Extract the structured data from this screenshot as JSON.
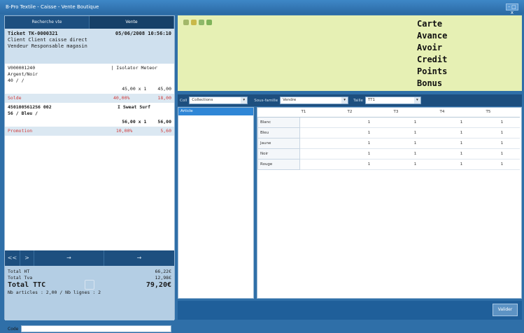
{
  "window": {
    "title": "B-Pro Textile - Caisse - Vente Boutique",
    "controls": "- □ x"
  },
  "tabs": [
    "Recherche vte",
    "Vente"
  ],
  "ticket": {
    "number_label": "Ticket   TK-0000321",
    "date": "05/06/2008 10:56:10",
    "client_line": "Client Client caisse  direct",
    "vendor_line": "Vendeur Responsable magasin"
  },
  "lines": [
    {
      "ref": "V000001240",
      "desc": "| Isolator Meteor",
      "detail1": "Argent/Noir",
      "detail2": "40 /  /",
      "qty": "45,00 x 1",
      "amount": "45,00",
      "discount_label": "Solde",
      "discount_pct": "40,00%",
      "discount_amt": "18,00"
    },
    {
      "ref": "4501005612S6 002",
      "desc": "I Sweat Surf",
      "detail1": "56 / Bleu /",
      "qty": "56,00 x 1",
      "amount": "56,00",
      "discount_label": "Promotion",
      "discount_pct": "10,00%",
      "discount_amt": "5,60"
    }
  ],
  "bottom_toolbar": [
    "<<",
    ">",
    "→",
    "→"
  ],
  "totals": {
    "ht_label": "Total HT",
    "ht_value": "66,22€",
    "tva_label": "Total Tva",
    "tva_value": "12,98€",
    "ttc_label": "Total TTC",
    "ttc_value": "79,20€",
    "summary": "Nb articles : 2,00 / Nb lignes :  2"
  },
  "code_label": "Code",
  "payment_modes": [
    "Carte",
    "Avance",
    "Avoir",
    "Credit",
    "Points",
    "Bonus"
  ],
  "filters": {
    "l1": "Coll",
    "v1": "Collections",
    "l2": "Sous-famille",
    "v2": "Vendre",
    "l3": "Taille",
    "v3": "TT1"
  },
  "category_selected": "Article",
  "grid": {
    "headers": [
      "",
      "T1",
      "T2",
      "T3",
      "T4",
      "T5"
    ],
    "rows": [
      {
        "label": "Blanc",
        "values": [
          "",
          "1",
          "1",
          "1",
          "1"
        ]
      },
      {
        "label": "Bleu",
        "values": [
          "",
          "1",
          "1",
          "1",
          "1"
        ]
      },
      {
        "label": "Jaune",
        "values": [
          "",
          "1",
          "1",
          "1",
          "1"
        ]
      },
      {
        "label": "Noir",
        "values": [
          "",
          "1",
          "1",
          "1",
          "1"
        ]
      },
      {
        "label": "Rouge",
        "values": [
          "",
          "1",
          "1",
          "1",
          "1"
        ]
      }
    ]
  },
  "ok_button": "Valider",
  "colors": {
    "accent": "#1d4f7f",
    "message_bg": "#e6f0b4",
    "discount": "#d13b3b"
  }
}
